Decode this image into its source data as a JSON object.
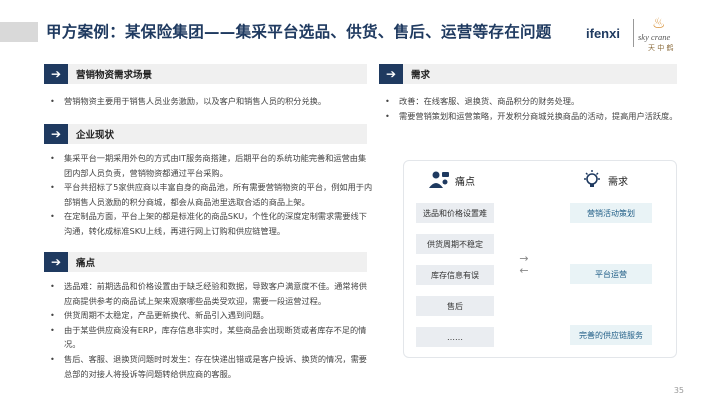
{
  "title": "甲方案例：某保险集团——集采平台选品、供货、售后、运营等存在问题",
  "logos": {
    "ifenxi": "ifenxi",
    "skycrane": "sky crane",
    "skycrane_cn": "天 中 鹤"
  },
  "sections": {
    "scene": {
      "label": "营销物资需求场景",
      "bullets": [
        "营销物资主要用于销售人员业务激励，以及客户和销售人员的积分兑换。"
      ]
    },
    "current": {
      "label": "企业现状",
      "bullets": [
        "集采平台一期采用外包的方式由IT服务商搭建，后期平台的系统功能完善和运营由集团内部人员负责，营销物资都通过平台采购。",
        "平台共招标了5家供应商以丰富自身的商品池，所有需要营销物资的平台，例如用于内部销售人员激励的积分商城，都会从商品池里选取合适的商品上架。",
        "在定制品方面，平台上架的都是标准化的商品SKU，个性化的深度定制需求需要线下沟通，转化成标准SKU上线，再进行网上订购和供应链管理。"
      ]
    },
    "pain": {
      "label": "痛点",
      "bullets": [
        "选品难：前期选品和价格设置由于缺乏经验和数据，导致客户满意度不佳。通常将供应商提供参考的商品试上架来观察哪些品类受欢迎，需要一段运营过程。",
        "供货周期不太稳定，产品更新换代、新品引入遇到问题。",
        "由于某些供应商没有ERP，库存信息非实时，某些商品会出现断货或者库存不足的情况。",
        "售后、客服、退换货问题时时发生：存在快递出错或是客户投诉、换货的情况，需要总部的对接人将投诉等问题转给供应商的客服。"
      ]
    },
    "need": {
      "label": "需求",
      "bullets": [
        "改善：在线客服、退换货、商品积分的财务处理。",
        "需要营销策划和运营策略，开发积分商城兑换商品的活动，提高用户活跃度。"
      ]
    }
  },
  "diagram": {
    "pain_title": "痛点",
    "need_title": "需求",
    "pain_items": [
      "选品和价格设置难",
      "供货周期不稳定",
      "库存信息有误",
      "售后",
      "……"
    ],
    "need_items": [
      "营销活动策划",
      "平台运营",
      "完善的供应链服务"
    ],
    "exchange_icon": "exchange-arrows-icon"
  },
  "page_number": "35",
  "colors": {
    "primary": "#1f3a60",
    "head_bg": "#f0f0f0",
    "box_bg": "#eaedf1",
    "need_box_bg": "#e9f3f6"
  }
}
